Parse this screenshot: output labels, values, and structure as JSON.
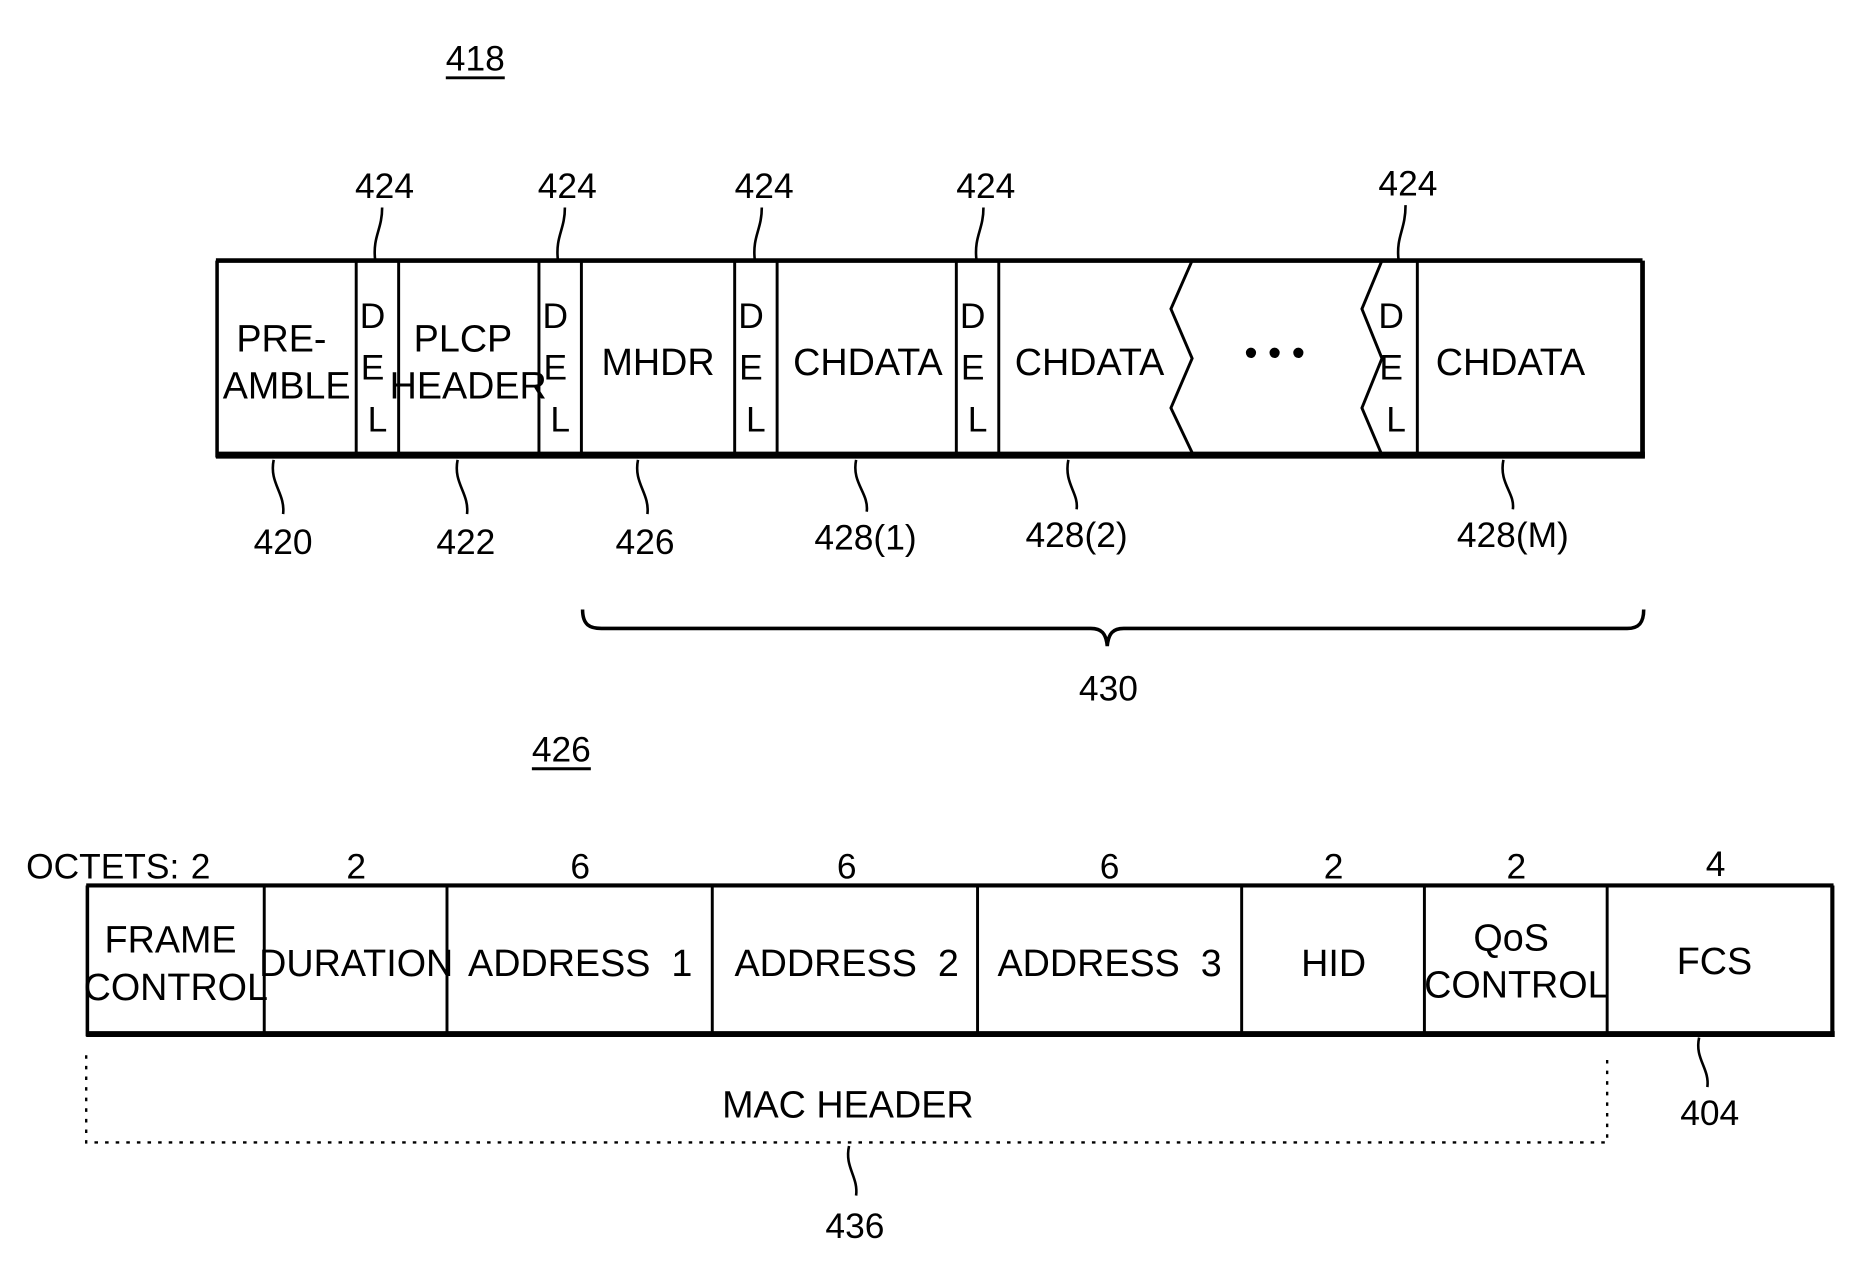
{
  "figure_418": {
    "ref_label": "418",
    "fields": [
      {
        "id": "preamble",
        "label_lines": [
          "PRE-",
          "AMBLE"
        ],
        "ref": "420"
      },
      {
        "id": "del1",
        "label_lines": [
          "D",
          "E",
          "L"
        ],
        "ref": "424"
      },
      {
        "id": "plcp",
        "label_lines": [
          "PLCP",
          "HEADER"
        ],
        "ref": "422"
      },
      {
        "id": "del2",
        "label_lines": [
          "D",
          "E",
          "L"
        ],
        "ref": "424"
      },
      {
        "id": "mhdr",
        "label_lines": [
          "MHDR"
        ],
        "ref": "426"
      },
      {
        "id": "del3",
        "label_lines": [
          "D",
          "E",
          "L"
        ],
        "ref": "424"
      },
      {
        "id": "chdata1",
        "label_lines": [
          "CHDATA"
        ],
        "ref": "428(1)"
      },
      {
        "id": "del4",
        "label_lines": [
          "D",
          "E",
          "L"
        ],
        "ref": "424"
      },
      {
        "id": "chdata2",
        "label_lines": [
          "CHDATA"
        ],
        "ref": "428(2)"
      },
      {
        "id": "ellipsis",
        "label_lines": [
          "• • •"
        ],
        "ref": ""
      },
      {
        "id": "del5",
        "label_lines": [
          "D",
          "E",
          "L"
        ],
        "ref": "424"
      },
      {
        "id": "chdataM",
        "label_lines": [
          "CHDATA"
        ],
        "ref": "428(M)"
      }
    ],
    "brace_ref": "430"
  },
  "figure_426": {
    "ref_label": "426",
    "octets_label": "OCTETS:",
    "fields": [
      {
        "id": "frame-control",
        "label_lines": [
          "FRAME",
          "CONTROL"
        ],
        "octets": "2"
      },
      {
        "id": "duration",
        "label_lines": [
          "DURATION"
        ],
        "octets": "2"
      },
      {
        "id": "address-1",
        "label_lines": [
          "ADDRESS  1"
        ],
        "octets": "6"
      },
      {
        "id": "address-2",
        "label_lines": [
          "ADDRESS  2"
        ],
        "octets": "6"
      },
      {
        "id": "address-3",
        "label_lines": [
          "ADDRESS  3"
        ],
        "octets": "6"
      },
      {
        "id": "hid",
        "label_lines": [
          "HID"
        ],
        "octets": "2"
      },
      {
        "id": "qos-control",
        "label_lines": [
          "QoS",
          "CONTROL"
        ],
        "octets": "2"
      },
      {
        "id": "fcs",
        "label_lines": [
          "FCS"
        ],
        "octets": "4"
      }
    ],
    "mac_header_label": "MAC HEADER",
    "mac_header_ref": "436",
    "fcs_ref": "404"
  }
}
